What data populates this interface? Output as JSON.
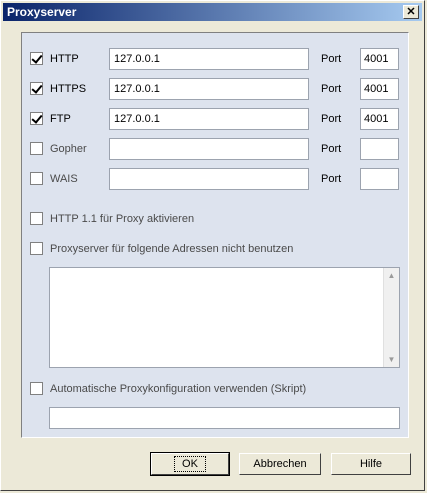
{
  "window": {
    "title": "Proxyserver",
    "close_glyph": "✕"
  },
  "port_label": "Port",
  "proxies": [
    {
      "checked": true,
      "label": "HTTP",
      "address": "127.0.0.1",
      "port": "4001"
    },
    {
      "checked": true,
      "label": "HTTPS",
      "address": "127.0.0.1",
      "port": "4001"
    },
    {
      "checked": true,
      "label": "FTP",
      "address": "127.0.0.1",
      "port": "4001"
    },
    {
      "checked": false,
      "label": "Gopher",
      "address": "",
      "port": ""
    },
    {
      "checked": false,
      "label": "WAIS",
      "address": "",
      "port": ""
    }
  ],
  "options": {
    "http11_label": "HTTP 1.1 für Proxy aktivieren",
    "bypass_label": "Proxyserver für folgende Adressen nicht benutzen",
    "bypass_list": "",
    "auto_config_label": "Automatische Proxykonfiguration verwenden (Skript)",
    "auto_config_script": ""
  },
  "buttons": {
    "ok": "OK",
    "cancel": "Abbrechen",
    "help": "Hilfe"
  }
}
